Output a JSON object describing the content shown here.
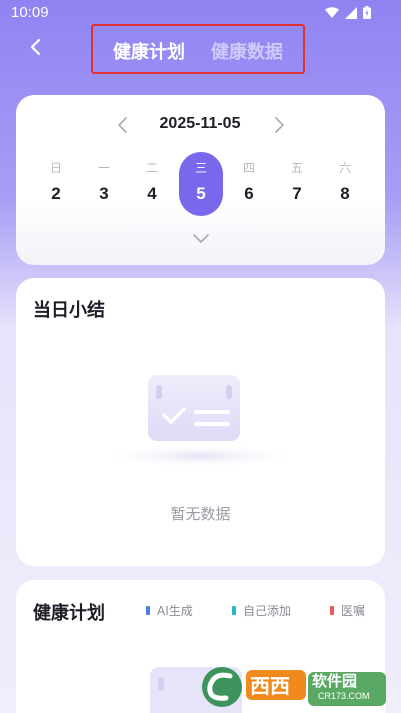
{
  "status_bar": {
    "time": "10:09"
  },
  "header": {
    "tabs": [
      {
        "label": "健康计划",
        "active": true
      },
      {
        "label": "健康数据",
        "active": false
      }
    ],
    "highlight_color": "#e03131"
  },
  "calendar": {
    "date": "2025-11-05",
    "days": [
      {
        "weekday": "日",
        "day": "2"
      },
      {
        "weekday": "一",
        "day": "3"
      },
      {
        "weekday": "二",
        "day": "4"
      },
      {
        "weekday": "三",
        "day": "5",
        "selected": true
      },
      {
        "weekday": "四",
        "day": "6"
      },
      {
        "weekday": "五",
        "day": "7"
      },
      {
        "weekday": "六",
        "day": "8"
      }
    ],
    "accent_color": "#7a68ec"
  },
  "summary": {
    "title": "当日小结",
    "empty_text": "暂无数据"
  },
  "plan": {
    "title": "健康计划",
    "legend": [
      {
        "label": "AI生成",
        "color": "#4f7fe0"
      },
      {
        "label": "自己添加",
        "color": "#22b8c8"
      },
      {
        "label": "医嘱",
        "color": "#ee5a5a"
      }
    ]
  },
  "watermark": {
    "brand": "西西",
    "tag": "软件园",
    "url": "CR173.COM"
  }
}
